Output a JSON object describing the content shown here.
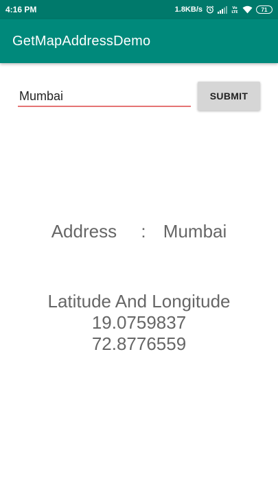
{
  "status_bar": {
    "time": "4:16 PM",
    "net_speed": "1.8KB/s",
    "battery": "71",
    "icons": [
      "alarm-icon",
      "signal-icon",
      "volte-icon",
      "wifi-icon",
      "battery-icon"
    ]
  },
  "app_bar": {
    "title": "GetMapAddressDemo",
    "color": "#00897b"
  },
  "form": {
    "input_value": "Mumbai",
    "submit_label": "SUBMIT",
    "underline_color": "#e57373"
  },
  "result": {
    "address_label": "Address",
    "separator": ":",
    "address_value": "Mumbai",
    "latlng_label": "Latitude And Longitude",
    "latitude": "19.0759837",
    "longitude": "72.8776559"
  }
}
